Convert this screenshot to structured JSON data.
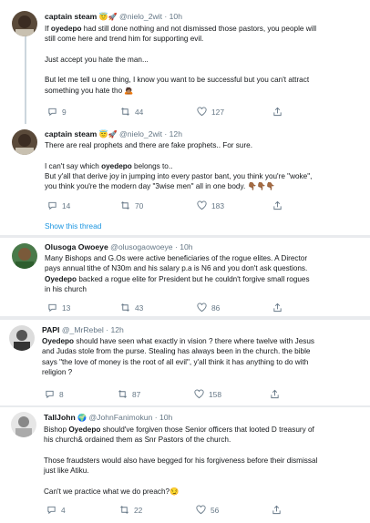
{
  "tweets": [
    {
      "name": "captain steam",
      "badges": "😇🚀",
      "handle": "@nielo_2wit",
      "dot": "·",
      "time": "10h",
      "lines": [
        "If ",
        "oyedepo",
        " had still done nothing and not dismissed those pastors, you people will",
        "still come here and trend him for supporting evil.",
        "",
        "Just accept you hate the man...",
        "",
        "But let me tell u one thing, I know you want to be successful but you can't attract",
        "something you hate tho 🙇🏽"
      ],
      "replies": "9",
      "retweets": "44",
      "likes": "127"
    },
    {
      "name": "captain steam",
      "badges": "😇🚀",
      "handle": "@nielo_2wit",
      "dot": "·",
      "time": "12h",
      "lines": [
        "There are real prophets and there are fake prophets.. For sure.",
        "",
        "I can't say which ",
        "oyedepo",
        " belongs to..",
        "But y'all that derive joy in jumping into every pastor bant, you think you're \"woke\",",
        "you think you're the modern day \"3wise men\" all in one body. 👇🏾👇🏾👇🏾"
      ],
      "replies": "14",
      "retweets": "70",
      "likes": "183",
      "show_thread": "Show this thread"
    },
    {
      "name": "Olusoga Owoeye",
      "handle": "@olusogaowoeye",
      "dot": "·",
      "time": "10h",
      "lines": [
        "Many Bishops and G.Os were active beneficiaries of the rogue elites. A Director",
        "pays annual tithe of N30m and his salary p.a is N6 and you don't ask questions.",
        "Oyedepo",
        " backed a rogue elite for President but he couldn't forgive  small rogues",
        "in his church"
      ],
      "replies": "13",
      "retweets": "43",
      "likes": "86"
    },
    {
      "name": "PAPI",
      "handle": "@_MrRebel",
      "dot": "·",
      "time": "12h",
      "lines": [
        "Oyedepo",
        " should have seen what exactly in vision ? there where twelve with Jesus",
        "and Judas stole from the purse. Stealing has always been in the church. the bible",
        "says \"the love of money is the root of all evil\", y'all think it has anything to do with",
        "religion ?"
      ],
      "replies": "8",
      "retweets": "87",
      "likes": "158"
    },
    {
      "name": "TallJohn",
      "badges": "🌍",
      "handle": "@JohnFanimokun",
      "dot": "·",
      "time": "10h",
      "lines": [
        "Bishop ",
        "Oyedepo",
        " should've forgiven those Senior officers that looted D treasury of",
        "his church& ordained them as Snr Pastors of the church.",
        "",
        "Those fraudsters would also have begged for his forgiveness before their dismissal",
        "just like Atiku.",
        "",
        "Can't we practice what we do preach?😏"
      ],
      "replies": "4",
      "retweets": "22",
      "likes": "56"
    }
  ]
}
